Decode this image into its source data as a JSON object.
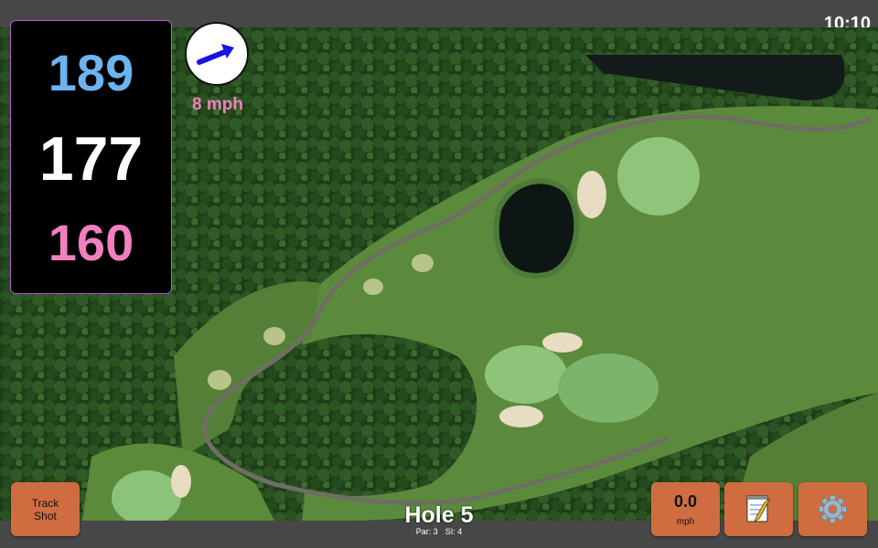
{
  "status_bar": {
    "time": "10:10"
  },
  "distances": {
    "back": "189",
    "middle": "177",
    "front": "160"
  },
  "wind": {
    "speed": "8 mph",
    "direction_icon": "arrow-right-icon"
  },
  "buttons": {
    "track_shot_line1": "Track",
    "track_shot_line2": "Shot",
    "speed_value": "0.0",
    "speed_unit": "mph",
    "notes_icon": "notepad-icon",
    "settings_icon": "gear-icon"
  },
  "hole": {
    "title": "Hole 5",
    "par": "Par: 3",
    "si": "SI: 4"
  },
  "colors": {
    "back_distance": "#6cb4f0",
    "middle_distance": "#ffffff",
    "front_distance": "#f27fc0",
    "button": "#cf6d40",
    "bar": "#474747"
  }
}
